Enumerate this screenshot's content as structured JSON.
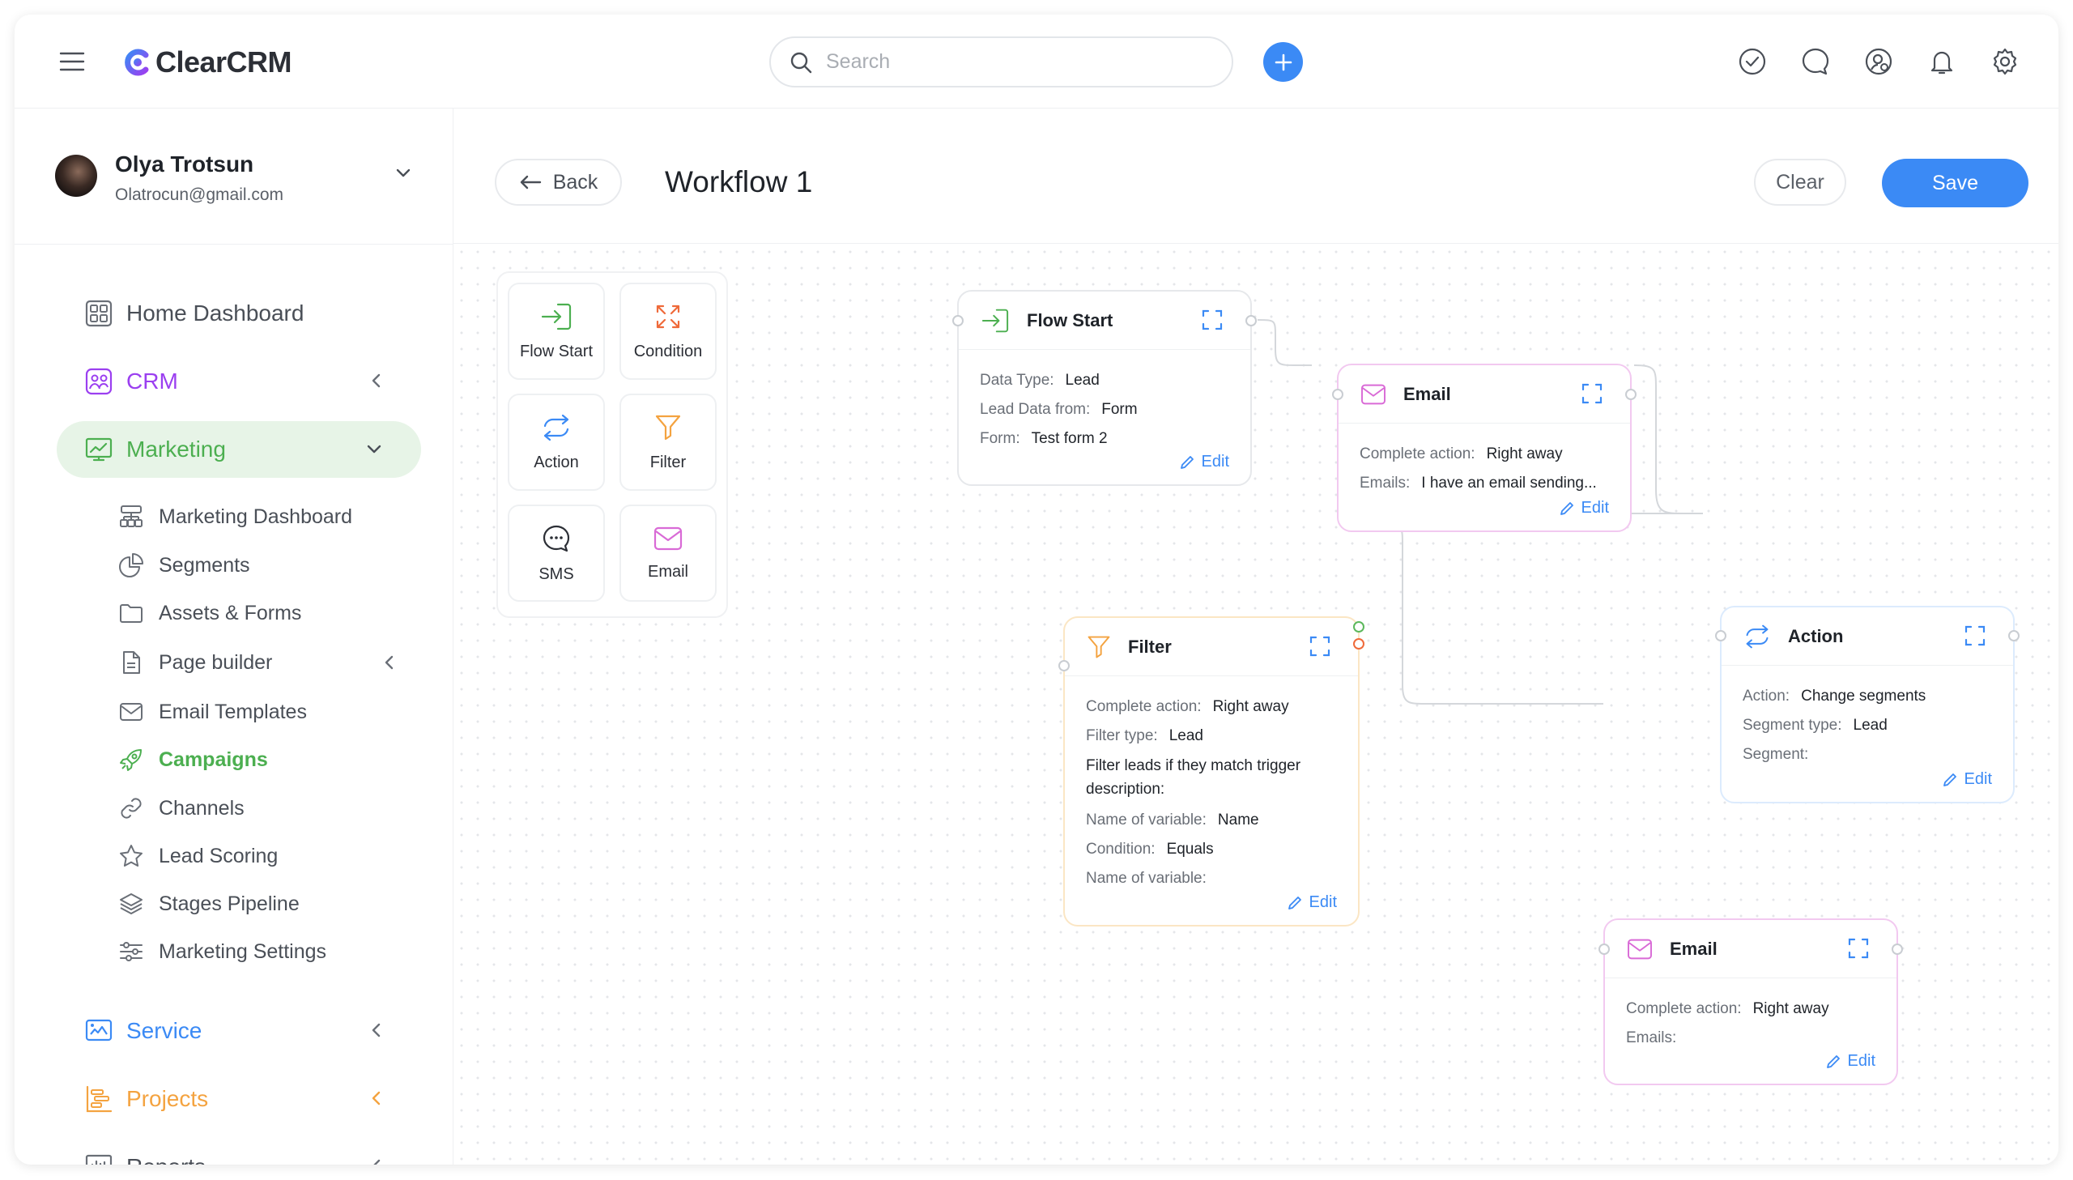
{
  "app": {
    "name": "ClearCRM"
  },
  "search": {
    "placeholder": "Search"
  },
  "user": {
    "name": "Olya Trotsun",
    "email": "Olatrocun@gmail.com"
  },
  "sidebar": {
    "items": [
      {
        "label": "Home Dashboard",
        "icon": "dashboard-icon",
        "color": "#4a4f57"
      },
      {
        "label": "CRM",
        "icon": "crm-icon",
        "color": "#9b3ff0"
      },
      {
        "label": "Marketing",
        "icon": "chart-icon",
        "color": "#4caf50"
      },
      {
        "label": "Service",
        "icon": "service-icon",
        "color": "#3b8af5"
      },
      {
        "label": "Projects",
        "icon": "projects-icon",
        "color": "#f4a340"
      },
      {
        "label": "Reports",
        "icon": "reports-icon",
        "color": "#4a4f57"
      }
    ],
    "marketing_sub": [
      {
        "label": "Marketing Dashboard",
        "icon": "hierarchy-icon"
      },
      {
        "label": "Segments",
        "icon": "pie-chart-icon"
      },
      {
        "label": "Assets & Forms",
        "icon": "folder-icon"
      },
      {
        "label": "Page builder",
        "icon": "document-icon"
      },
      {
        "label": "Email Templates",
        "icon": "mail-icon"
      },
      {
        "label": "Campaigns",
        "icon": "rocket-icon"
      },
      {
        "label": "Channels",
        "icon": "link-icon"
      },
      {
        "label": "Lead Scoring",
        "icon": "star-icon"
      },
      {
        "label": "Stages Pipeline",
        "icon": "layers-icon"
      },
      {
        "label": "Marketing Settings",
        "icon": "sliders-icon"
      }
    ]
  },
  "header": {
    "back": "Back",
    "title": "Workflow 1",
    "clear": "Clear",
    "save": "Save"
  },
  "palette": [
    {
      "label": "Flow Start",
      "icon": "enter-icon"
    },
    {
      "label": "Condition",
      "icon": "condition-icon"
    },
    {
      "label": "Action",
      "icon": "repeat-icon"
    },
    {
      "label": "Filter",
      "icon": "filter-icon"
    },
    {
      "label": "SMS",
      "icon": "chat-icon"
    },
    {
      "label": "Email",
      "icon": "mail-icon"
    }
  ],
  "nodes": {
    "flow_start": {
      "title": "Flow Start",
      "rows": [
        {
          "label": "Data Type:",
          "value": "Lead"
        },
        {
          "label": "Lead Data from:",
          "value": "Form"
        },
        {
          "label": "Form:",
          "value": "Test form 2"
        }
      ],
      "edit": "Edit"
    },
    "email1": {
      "title": "Email",
      "rows": [
        {
          "label": "Complete action:",
          "value": "Right away"
        },
        {
          "label": "Emails:",
          "value": "I have an email sending..."
        }
      ],
      "edit": "Edit"
    },
    "filter": {
      "title": "Filter",
      "rows_top": [
        {
          "label": "Complete action:",
          "value": "Right away"
        },
        {
          "label": "Filter type:",
          "value": "Lead"
        }
      ],
      "description": "Filter leads if they match trigger description:",
      "rows_bottom": [
        {
          "label": "Name of variable:",
          "value": "Name"
        },
        {
          "label": "Condition:",
          "value": "Equals"
        },
        {
          "label": "Name of variable:",
          "value": ""
        }
      ],
      "edit": "Edit"
    },
    "action": {
      "title": "Action",
      "rows": [
        {
          "label": "Action:",
          "value": "Change segments"
        },
        {
          "label": "Segment type:",
          "value": "Lead"
        },
        {
          "label": "Segment:",
          "value": ""
        }
      ],
      "edit": "Edit"
    },
    "email2": {
      "title": "Email",
      "rows": [
        {
          "label": "Complete action:",
          "value": "Right away"
        },
        {
          "label": "Emails:",
          "value": ""
        }
      ],
      "edit": "Edit"
    }
  },
  "colors": {
    "accent": "#3b8af5",
    "marketing": "#4caf50",
    "crm": "#9b3ff0",
    "email": "#d96ad6",
    "filter": "#f4a340",
    "flow": "#4caf50"
  }
}
